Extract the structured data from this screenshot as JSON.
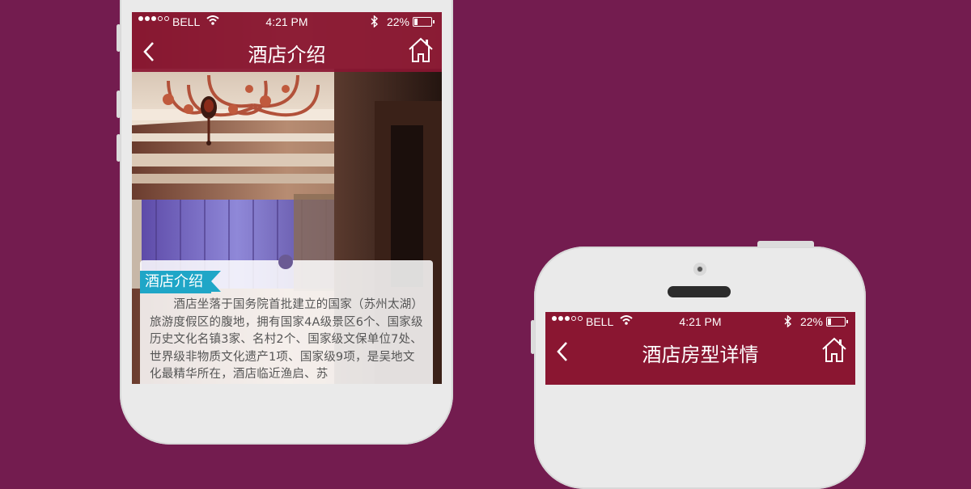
{
  "phone1": {
    "status": {
      "carrier": "BELL",
      "time": "4:21 PM",
      "battery": "22%",
      "battery_level": 0.22
    },
    "nav": {
      "title": "酒店介绍"
    },
    "section_tag": "酒店介绍",
    "body_text": "　　酒店坐落于国务院首批建立的国家（苏州太湖）旅游度假区的腹地，拥有国家4A级景区6个、国家级历史文化名镇3家、名村2个、国家级文保单位7处、世界级非物质文化遗产1项、国家级9项，是吴地文化最精华所在，酒店临近渔启、苏"
  },
  "phone2": {
    "status": {
      "carrier": "BELL",
      "time": "4:21 PM",
      "battery": "22%",
      "battery_level": 0.22
    },
    "nav": {
      "title": "酒店房型详情"
    }
  },
  "colors": {
    "background": "#731c4f",
    "nav_bar": "#8a1631",
    "tag_blue": "#1fa6c7",
    "phone_body": "#eaeaea"
  }
}
